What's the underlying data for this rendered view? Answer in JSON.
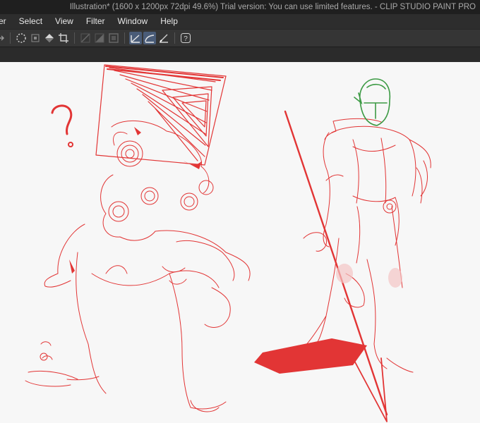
{
  "window": {
    "title": "Illustration* (1600 x 1200px 72dpi 49.6%)  Trial version: You can use limited features. - CLIP STUDIO PAINT PRO"
  },
  "menu": {
    "items": [
      {
        "label": "er"
      },
      {
        "label": "Select"
      },
      {
        "label": "View"
      },
      {
        "label": "Filter"
      },
      {
        "label": "Window"
      },
      {
        "label": "Help"
      }
    ]
  },
  "toolbar": {
    "icons": [
      "redo-icon",
      "snap-icon",
      "transform-icon",
      "fill-icon",
      "crop-icon",
      "ruler-icon",
      "gradient-icon",
      "frame-icon",
      "stroke-correction-icon",
      "curve-icon",
      "pen-pressure-icon",
      "help-icon"
    ],
    "active": [
      "stroke-correction-icon",
      "curve-icon"
    ]
  },
  "canvas": {
    "background": "#f7f7f7",
    "sketch_color": "#e23535",
    "helmet_color": "#3c9a44",
    "question_mark": "?"
  }
}
